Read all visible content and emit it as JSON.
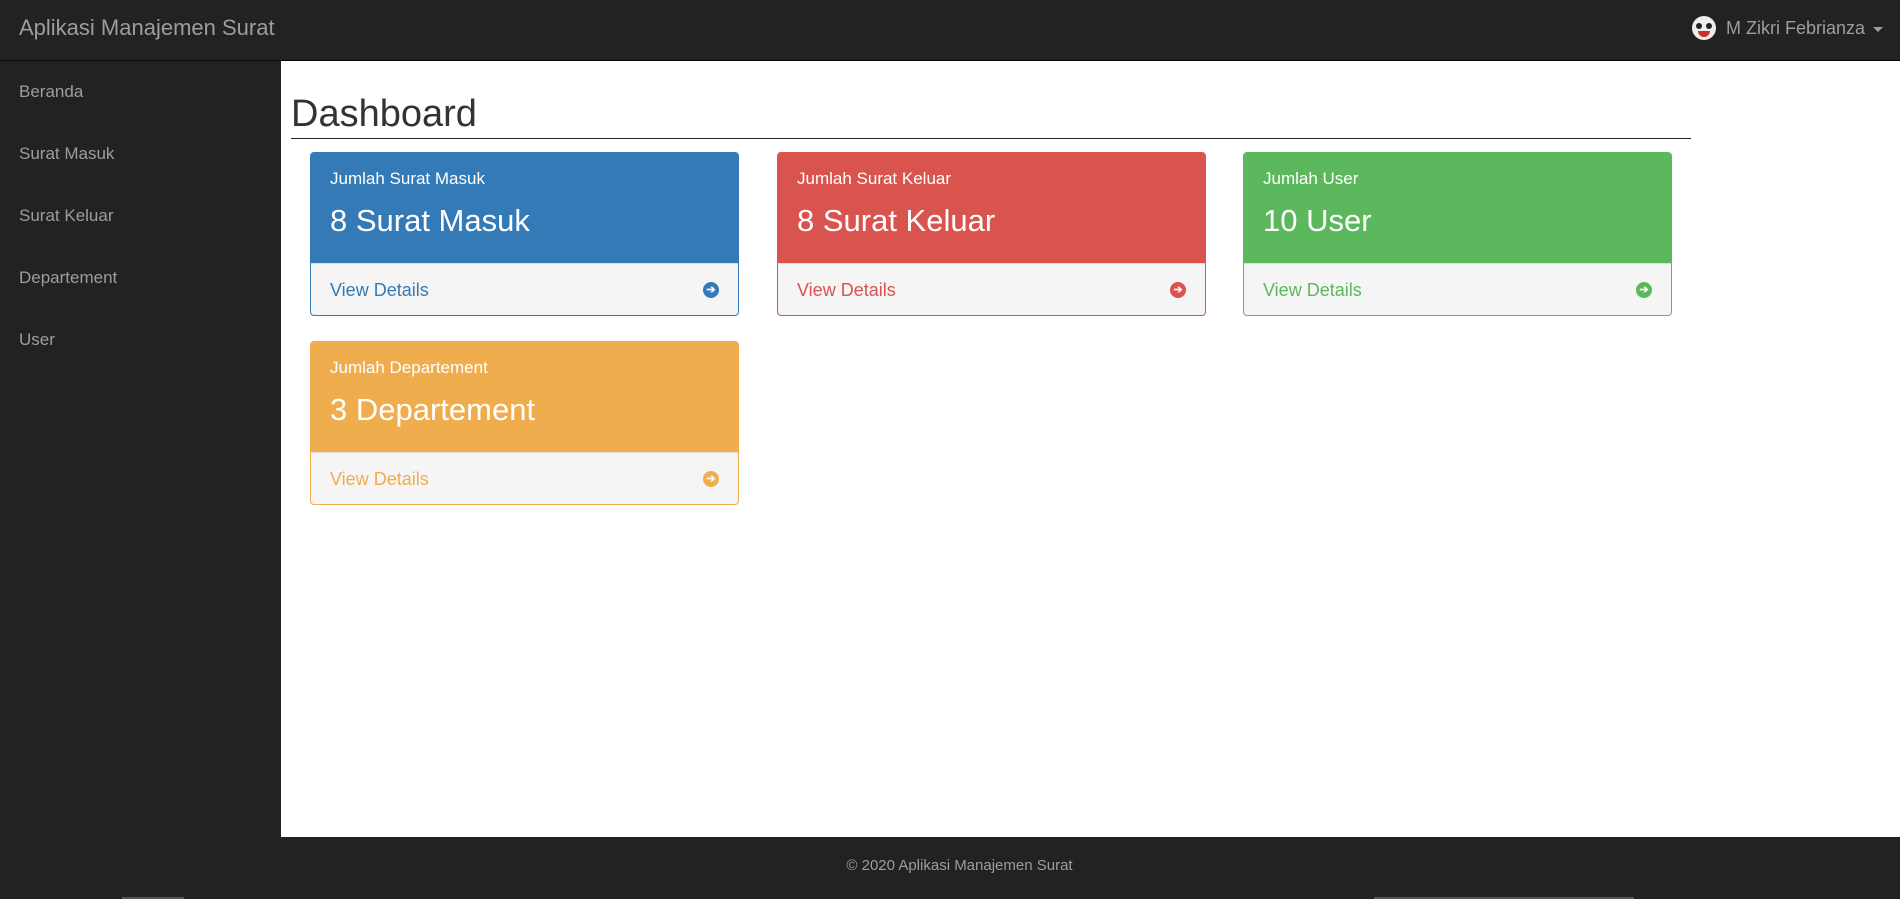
{
  "app": {
    "title": "Aplikasi Manajemen Surat"
  },
  "user": {
    "name": "M Zikri Febrianza",
    "avatar_icon": "user-avatar-icon"
  },
  "sidebar": {
    "items": [
      {
        "label": "Beranda"
      },
      {
        "label": "Surat Masuk"
      },
      {
        "label": "Surat Keluar"
      },
      {
        "label": "Departement"
      },
      {
        "label": "User"
      }
    ]
  },
  "main": {
    "title": "Dashboard"
  },
  "panels": [
    {
      "caption": "Jumlah Surat Masuk",
      "value": "8 Surat Masuk",
      "link": "View Details",
      "color": "#337ab7"
    },
    {
      "caption": "Jumlah Surat Keluar",
      "value": "8 Surat Keluar",
      "link": "View Details",
      "color": "#d9534f"
    },
    {
      "caption": "Jumlah User",
      "value": "10 User",
      "link": "View Details",
      "color": "#5cb85c"
    },
    {
      "caption": "Jumlah Departement",
      "value": "3 Departement",
      "link": "View Details",
      "color": "#f0ad4e"
    }
  ],
  "footer": {
    "text": "© 2020 Aplikasi Manajemen Surat"
  }
}
